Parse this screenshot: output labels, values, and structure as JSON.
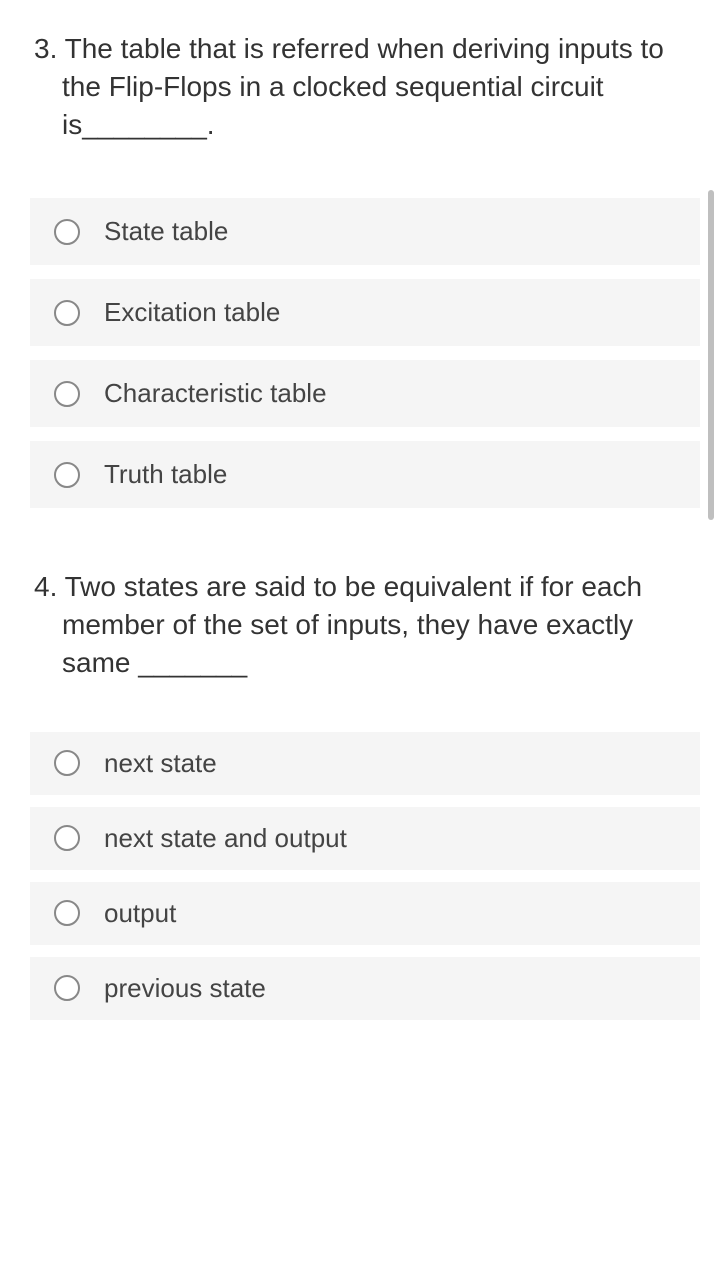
{
  "questions": [
    {
      "number": "3.",
      "text": "3. The table that is referred when deriving inputs to the Flip-Flops in a clocked sequential circuit is________.",
      "options": [
        {
          "label": "State table"
        },
        {
          "label": "Excitation table"
        },
        {
          "label": "Characteristic table"
        },
        {
          "label": "Truth table"
        }
      ]
    },
    {
      "number": "4.",
      "text": "4. Two states are said to be equivalent if for each member of the set of inputs, they have exactly same _______",
      "options": [
        {
          "label": "next state"
        },
        {
          "label": "next state and output"
        },
        {
          "label": "output"
        },
        {
          "label": "previous state"
        }
      ]
    }
  ]
}
